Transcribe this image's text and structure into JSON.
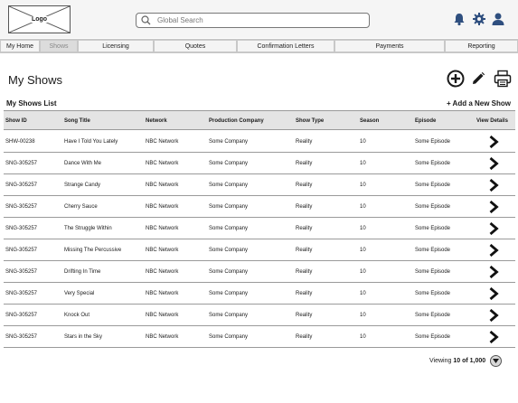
{
  "header": {
    "logo_label": "Logo",
    "search_placeholder": "Global Search",
    "icons": [
      "bell-icon",
      "gear-icon",
      "user-icon"
    ]
  },
  "nav": {
    "tabs": [
      {
        "label": "My Home",
        "active": false
      },
      {
        "label": "Shows",
        "active": true
      },
      {
        "label": "Licensing",
        "active": false
      },
      {
        "label": "Quotes",
        "active": false
      },
      {
        "label": "Confirmation Letters",
        "active": false
      },
      {
        "label": "Payments",
        "active": false
      },
      {
        "label": "Reporting",
        "active": false
      }
    ]
  },
  "page": {
    "title": "My Shows",
    "actions": [
      "add-circle-icon",
      "pencil-icon",
      "printer-icon"
    ],
    "list_title": "My Shows List",
    "add_link": "+ Add a New Show"
  },
  "table": {
    "columns": [
      "Show ID",
      "Song Title",
      "Network",
      "Production Company",
      "Show Type",
      "Season",
      "Episode",
      "View Details"
    ],
    "rows": [
      [
        "SHW-00238",
        "Have I Told You Lately",
        "NBC Network",
        "Some Company",
        "Reality",
        "10",
        "Some Episode"
      ],
      [
        "SNG-305257",
        "Dance With Me",
        "NBC Network",
        "Some Company",
        "Reality",
        "10",
        "Some Episode"
      ],
      [
        "SNG-305257",
        "Strange Candy",
        "NBC Network",
        "Some Company",
        "Reality",
        "10",
        "Some Episode"
      ],
      [
        "SNG-305257",
        "Cherry Sauce",
        "NBC Network",
        "Some Company",
        "Reality",
        "10",
        "Some Episode"
      ],
      [
        "SNG-305257",
        "The Struggle Within",
        "NBC Network",
        "Some Company",
        "Reality",
        "10",
        "Some Episode"
      ],
      [
        "SNG-305257",
        "Missing The Percussive",
        "NBC Network",
        "Some Company",
        "Reality",
        "10",
        "Some Episode"
      ],
      [
        "SNG-305257",
        "Drifting In Time",
        "NBC Network",
        "Some Company",
        "Reality",
        "10",
        "Some Episode"
      ],
      [
        "SNG-305257",
        "Very Special",
        "NBC Network",
        "Some Company",
        "Reality",
        "10",
        "Some Episode"
      ],
      [
        "SNG-305257",
        "Knock Out",
        "NBC Network",
        "Some Company",
        "Reality",
        "10",
        "Some Episode"
      ],
      [
        "SNG-305257",
        "Stars in the Sky",
        "NBC Network",
        "Some Company",
        "Reality",
        "10",
        "Some Episode"
      ]
    ]
  },
  "footer": {
    "viewing_prefix": "Viewing ",
    "viewing_range": "10 of 1,000",
    "more_icon": "chevron-down-icon"
  }
}
